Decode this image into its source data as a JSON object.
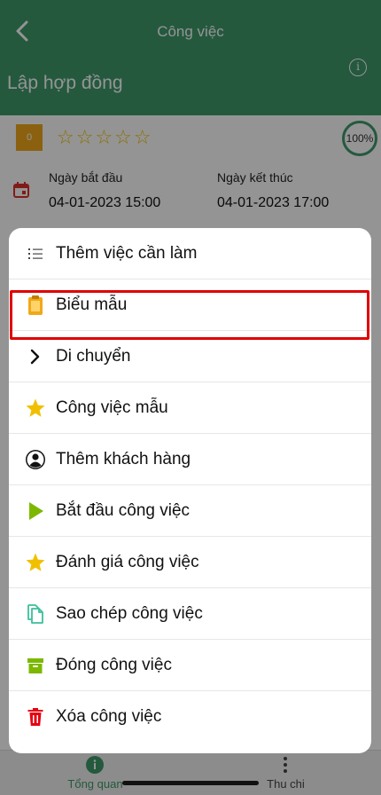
{
  "header": {
    "title": "Công việc",
    "task_name": "Lập hợp đồng",
    "info_icon": "info-icon",
    "back_icon": "chevron-left-icon"
  },
  "task": {
    "score": "0",
    "stars": "☆☆☆☆☆",
    "progress": "100%",
    "start_label": "Ngày bắt đầu",
    "start_value": "04-01-2023 15:00",
    "end_label": "Ngày kết thúc",
    "end_value": "04-01-2023 17:00"
  },
  "menu": {
    "items": [
      {
        "label": "Thêm việc cần làm",
        "icon": "list-icon"
      },
      {
        "label": "Biểu mẫu",
        "icon": "clipboard-icon"
      },
      {
        "label": "Di chuyển",
        "icon": "chevron-right-icon"
      },
      {
        "label": "Công việc mẫu",
        "icon": "star-icon"
      },
      {
        "label": "Thêm khách hàng",
        "icon": "user-icon"
      },
      {
        "label": "Bắt đầu công việc",
        "icon": "play-icon"
      },
      {
        "label": "Đánh giá công việc",
        "icon": "star-icon"
      },
      {
        "label": "Sao chép công việc",
        "icon": "copy-icon"
      },
      {
        "label": "Đóng công việc",
        "icon": "archive-icon"
      },
      {
        "label": "Xóa công việc",
        "icon": "trash-icon"
      }
    ],
    "highlighted_index": 1
  },
  "tabs": [
    {
      "label": "Tổng quan",
      "icon": "info-icon",
      "active": true
    },
    {
      "label": "Thu chi",
      "icon": "more-vertical-icon",
      "active": false
    }
  ],
  "colors": {
    "brand": "#3f9a6c",
    "highlight": "#e00000",
    "star": "#f0c000",
    "score_box": "#f0a81a",
    "play": "#7cb800",
    "trash": "#e60012"
  }
}
